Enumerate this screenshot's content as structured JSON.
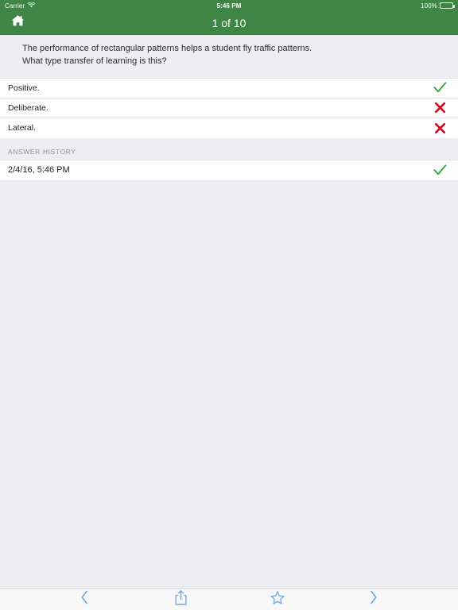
{
  "status_bar": {
    "carrier": "Carrier",
    "wifi_icon": "wifi-icon",
    "time": "5:46 PM",
    "battery_percent": "100%",
    "battery_icon": "battery-full-icon"
  },
  "nav_bar": {
    "home_icon": "home-icon",
    "title": "1 of 10",
    "background_color": "#3f8545"
  },
  "question": {
    "text": "The performance of rectangular patterns helps a student fly traffic patterns. What type transfer of learning is this?"
  },
  "options": [
    {
      "label": "Positive.",
      "mark": "check-icon",
      "mark_color": "#2eaa3a",
      "correct": true
    },
    {
      "label": "Deliberate.",
      "mark": "cross-icon",
      "mark_color": "#e1001a",
      "correct": false
    },
    {
      "label": "Lateral.",
      "mark": "cross-icon",
      "mark_color": "#e1001a",
      "correct": false
    }
  ],
  "answer_history": {
    "header": "ANSWER HISTORY",
    "entries": [
      {
        "timestamp": "2/4/16, 5:46 PM",
        "mark": "check-icon",
        "mark_color": "#2eaa3a"
      }
    ]
  },
  "toolbar": {
    "tint_color": "#6fa8e8",
    "items": [
      {
        "name": "previous-button",
        "icon": "chevron-left-icon"
      },
      {
        "name": "share-button",
        "icon": "share-icon"
      },
      {
        "name": "favorite-button",
        "icon": "star-outline-icon"
      },
      {
        "name": "next-button",
        "icon": "chevron-right-icon"
      }
    ]
  }
}
